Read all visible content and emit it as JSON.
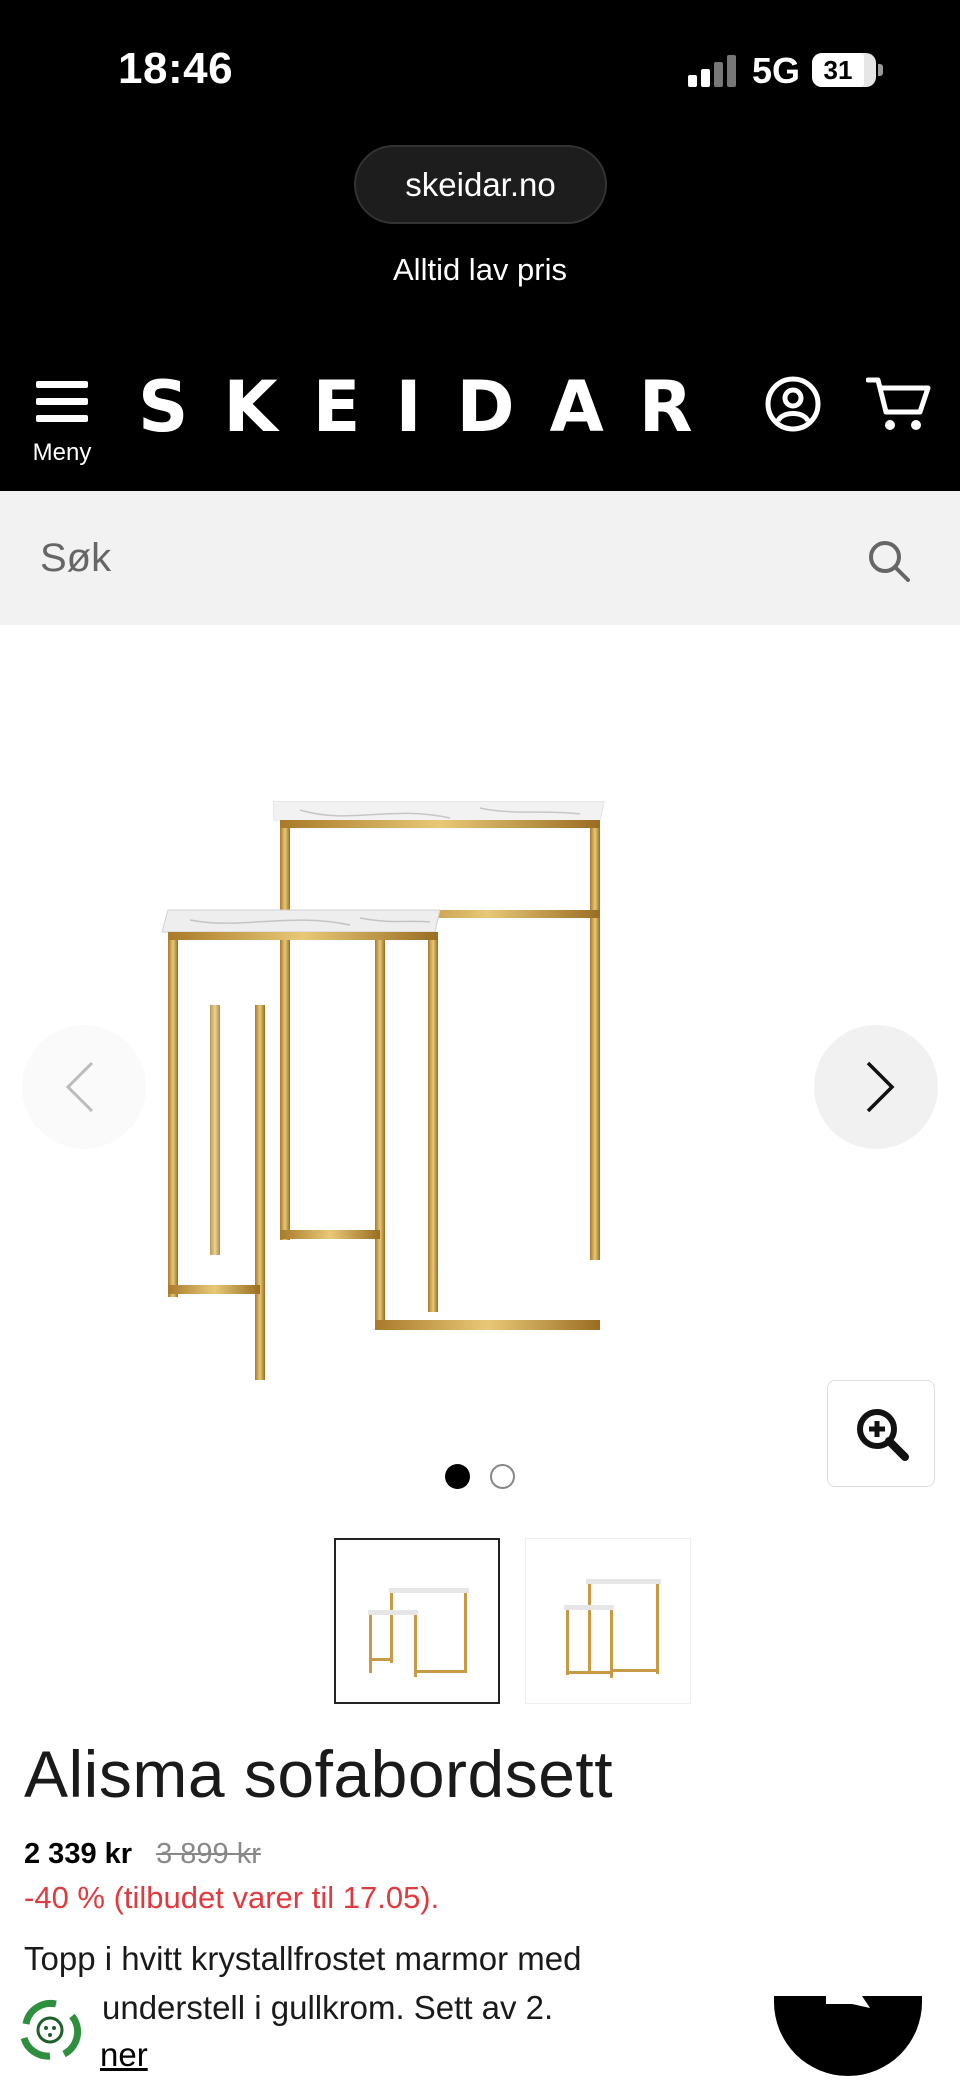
{
  "status_bar": {
    "time": "18:46",
    "network": "5G",
    "battery": "31"
  },
  "browser": {
    "url": "skeidar.no"
  },
  "header": {
    "tagline": "Alltid lav pris",
    "menu_label": "Meny",
    "logo": "SKEIDAR",
    "icons": [
      "hamburger-icon",
      "account-icon",
      "cart-icon"
    ],
    "background_color": "#000000"
  },
  "search": {
    "placeholder": "Søk",
    "value": ""
  },
  "gallery": {
    "image_count": 2,
    "active_index": 0,
    "thumbnails": [
      "nesting-tables-front",
      "nesting-tables-angle"
    ]
  },
  "product": {
    "title": "Alisma sofabordsett",
    "price": "2 339 kr",
    "old_price": "3 899 kr",
    "discount_text": "-40 % (tilbudet varer til 17.05).",
    "description_line1": "Topp i hvitt krystallfrostet marmor med",
    "description_line2": "understell i gullkrom. Sett av 2.",
    "read_more": "ner",
    "accent_color": "#e0393e"
  }
}
